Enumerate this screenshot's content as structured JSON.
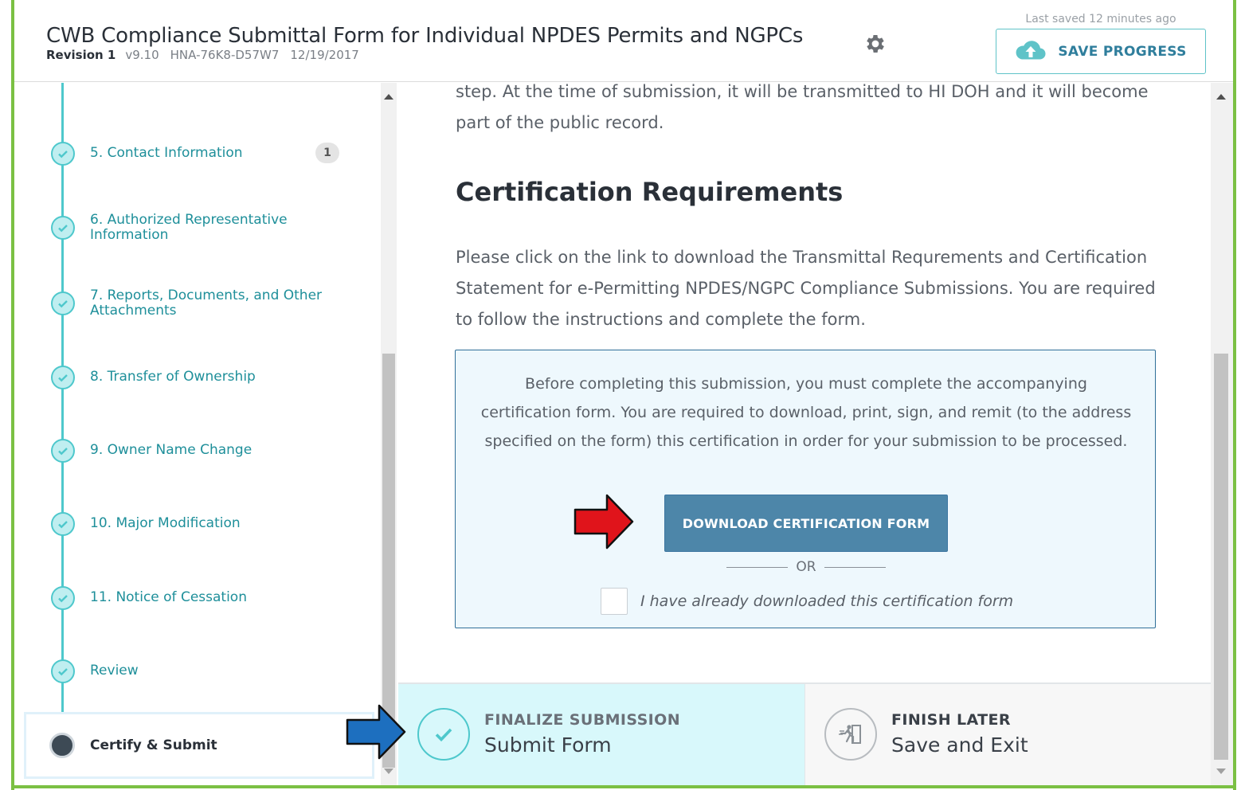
{
  "header": {
    "title": "CWB Compliance Submittal Form for Individual NPDES Permits and NGPCs",
    "revision": "Revision 1",
    "version": "v9.10",
    "form_id": "HNA-76K8-D57W7",
    "date": "12/19/2017",
    "last_saved": "Last saved 12 minutes ago",
    "save_label": "SAVE PROGRESS"
  },
  "sidebar": {
    "items": [
      {
        "label": "5. Contact Information",
        "badge": "1"
      },
      {
        "label": "6. Authorized Representative Information"
      },
      {
        "label": "7. Reports, Documents, and Other Attachments"
      },
      {
        "label": "8. Transfer of Ownership"
      },
      {
        "label": "9. Owner Name Change"
      },
      {
        "label": "10. Major Modification"
      },
      {
        "label": "11. Notice of Cessation"
      },
      {
        "label": "Review"
      }
    ],
    "active_label": "Certify & Submit"
  },
  "main": {
    "intro_text": "step. At the time of submission, it will be transmitted to HI DOH and it will become part of the public record.",
    "heading": "Certification Requirements",
    "body_text": "Please click on the link to download the Transmittal Requrements and Certification Statement for e-Permitting NPDES/NGPC Compliance Submissions.  You are required to follow the instructions and complete the form.",
    "notice_text": "Before completing this submission, you must complete the accompanying certification form. You are required to download, print, sign, and remit (to the address specified on the form) this certification in order for your submission to be processed.",
    "download_label": "DOWNLOAD CERTIFICATION FORM",
    "or_label": "OR",
    "checkbox_label": "I have already downloaded this certification form"
  },
  "footer": {
    "finalize_kicker": "FINALIZE SUBMISSION",
    "finalize_title": "Submit Form",
    "finish_kicker": "FINISH LATER",
    "finish_title": "Save and Exit"
  },
  "icons": {
    "gear": "gear-icon",
    "cloud_upload": "cloud-upload-icon",
    "check": "check-icon",
    "exit": "exit-icon"
  },
  "colors": {
    "accent": "#4ec8cc",
    "link": "#1e8f9a",
    "button": "#4d86a9",
    "frame": "#7bc043",
    "annotation_red": "#e0141b",
    "annotation_blue": "#1d6fbf"
  }
}
